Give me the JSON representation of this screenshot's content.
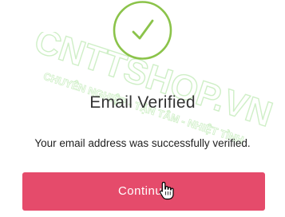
{
  "dialog": {
    "title": "Email Verified",
    "message": "Your email address was successfully verified.",
    "continue_label": "Continue"
  },
  "watermark": {
    "line1": "CNTTSHOP.VN",
    "line2": "CHUYÊN NGHIỆP - TẬN TÂM - NHIỆT TÌNH"
  },
  "icons": {
    "status": "check-circle-icon",
    "cursor": "hand-pointer-icon"
  },
  "colors": {
    "success": "#8bc34a",
    "button": "#e54b6b",
    "watermark": "#c8f2c0"
  }
}
